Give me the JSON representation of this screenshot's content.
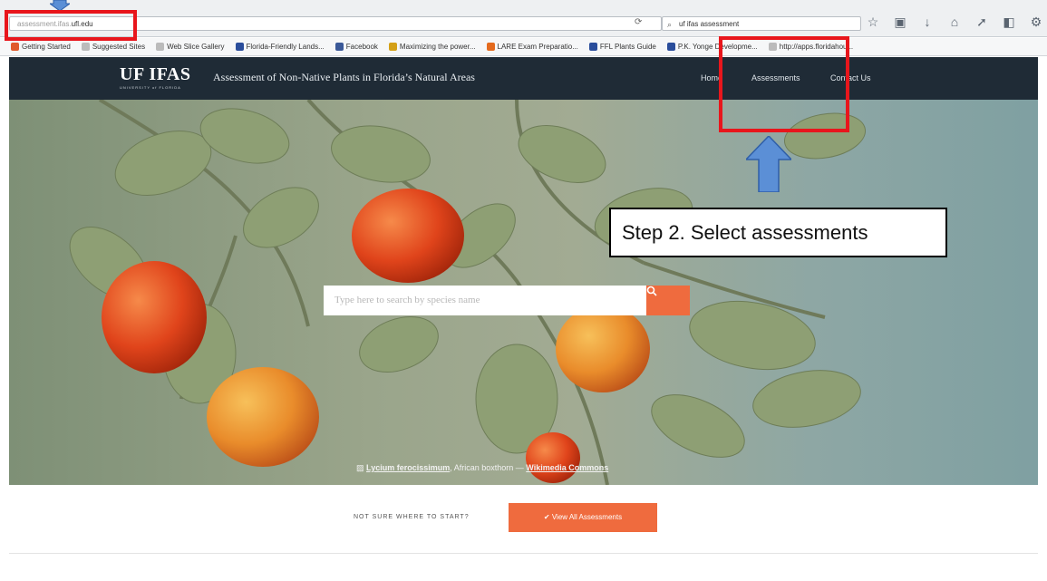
{
  "browser": {
    "url_host": "assessment.ifas.",
    "url_domain": "ufl.edu",
    "search_text": "uf ifas assessment",
    "toolbar_icons": [
      "star-icon",
      "clipboard-icon",
      "download-icon",
      "home-icon",
      "send-icon",
      "extension-icon",
      "settings-icon",
      "menu-icon"
    ],
    "bookmarks": [
      {
        "label": "Getting Started",
        "color": "#e05a2b"
      },
      {
        "label": "Suggested Sites",
        "color": "#bbbbbb"
      },
      {
        "label": "Web Slice Gallery",
        "color": "#bbbbbb"
      },
      {
        "label": "Florida-Friendly Lands...",
        "color": "#2a4d9b"
      },
      {
        "label": "Facebook",
        "color": "#3b5998"
      },
      {
        "label": "Maximizing the power...",
        "color": "#d4a017"
      },
      {
        "label": "LARE Exam Preparatio...",
        "color": "#e46a1e"
      },
      {
        "label": "FFL Plants Guide",
        "color": "#2a4d9b"
      },
      {
        "label": "P.K. Yonge Developme...",
        "color": "#2a4d9b"
      },
      {
        "label": "http://apps.floridahou...",
        "color": "#bbbbbb"
      }
    ]
  },
  "site": {
    "logo": "UF IFAS",
    "logo_sub": "UNIVERSITY of FLORIDA",
    "title": "Assessment of Non-Native Plants in Florida’s Natural Areas",
    "nav": {
      "home": "Home",
      "assessments": "Assessments",
      "contact": "Contact Us"
    }
  },
  "hero": {
    "search_placeholder": "Type here to search by species name",
    "caption_link": "Lycium ferocissimum",
    "caption_text": ", African boxthorn — ",
    "caption_source": "Wikimedia Commons"
  },
  "annotation": {
    "step_text": "Step 2. Select assessments"
  },
  "cta": {
    "prompt": "NOT SURE WHERE TO START?",
    "button": "View All Assessments"
  },
  "colors": {
    "nav_bg": "#1f2b36",
    "accent": "#ef6b3e",
    "highlight": "#e8161c",
    "arrow": "#5b8fd6"
  }
}
